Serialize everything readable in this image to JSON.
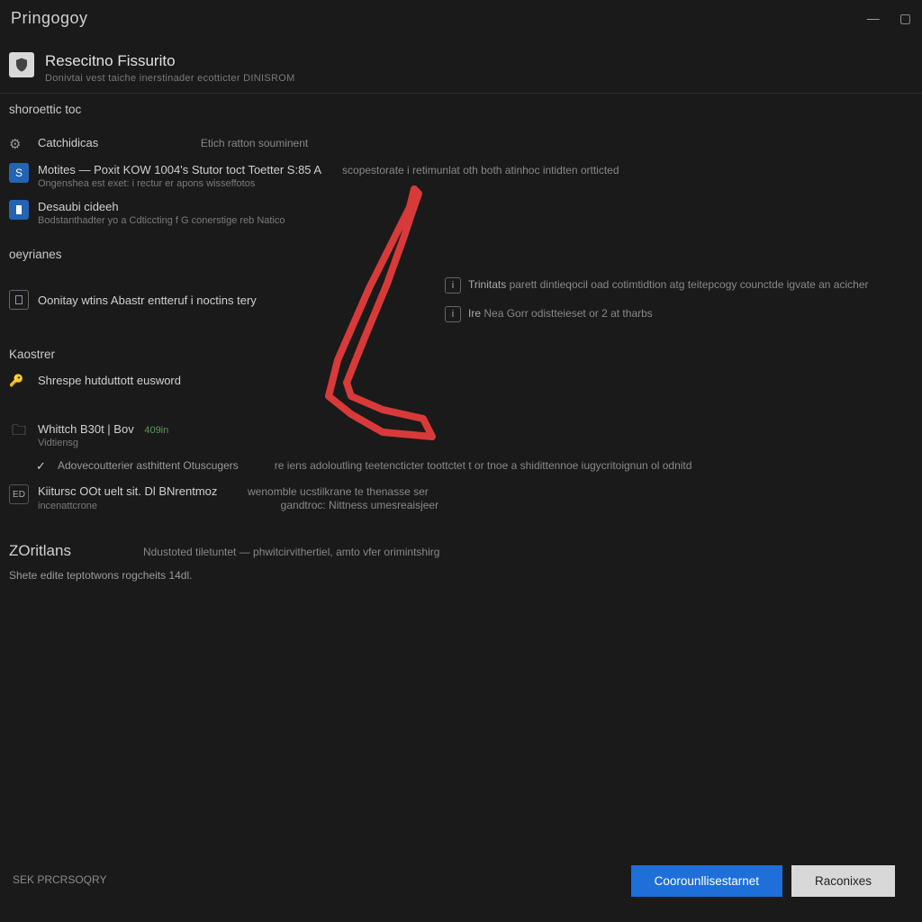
{
  "titlebar": {
    "title": "Pringogoy"
  },
  "header": {
    "title": "Resecitno Fissurito",
    "subtitle": "Donivtai vest taiche inerstinader ecotticter DINISROM"
  },
  "sections": {
    "s1": {
      "title": "shoroettic toc"
    },
    "cat": {
      "title": "Catchidicas",
      "side": "Etich ratton souminent"
    },
    "motiles": {
      "title": "Motites — Poxit KOW 1004's Stutor toct Toetter S:85 A",
      "desc": "Ongenshea est exet: i rectur er apons wisseffotos",
      "right": "scopestorate i retimunlat oth both atinhoc intidten ortticted"
    },
    "desaub": {
      "title": "Desaubi cideeh",
      "line": "Bodstanthadter yo  a Cdticcting f G conerstige reb Natico"
    },
    "oeyrianes": {
      "title": "oeyrianes"
    },
    "oonitay": {
      "title": "Oonitay wtins Abastr entteruf i noctins tery"
    },
    "info1": {
      "label": "Trinitats",
      "text": "parett dintieqocil oad cotimtidtion atg teitepcogy counctde igvate an acicher"
    },
    "info2": {
      "label": "Ire",
      "text": "Nea Gorr  odistteieset or 2 at tharbs"
    },
    "kaostrer": {
      "title": "Kaostrer"
    },
    "shrespe": {
      "title": "Shrespe hutduttott eusword"
    },
    "whittch": {
      "title": "Whittch B30t | Bov",
      "sub": "Vidtiensg",
      "hint": "409in"
    },
    "adovc": {
      "label": "Adovecoutterier asthittent Otuscugers",
      "right": "re iens adoloutling teetencticter toottctet t or tnoe a shidittennoe iugycritoignun ol odnitd"
    },
    "kiitu": {
      "title": "Kiitursc OOt uelt sit. Dl BNrentmoz",
      "sub": "incenattcrone",
      "side1": "wenomble ucstilkrane te thenasse ser",
      "side2": "gandtroc: Nittness umesreaisjeer"
    },
    "zoritans": {
      "title": "ZOritlans",
      "side": "Ndustoted tiletuntet — phwitcirvithertiel, amto vfer orimintshirg"
    },
    "shete": {
      "title": "Shete edite teptotwons rogcheits   14dl."
    },
    "sek": {
      "text": "SEK PRCRSOQRY"
    }
  },
  "buttons": {
    "primary": "Coorounllisestarnet",
    "secondary": "Raconixes"
  }
}
